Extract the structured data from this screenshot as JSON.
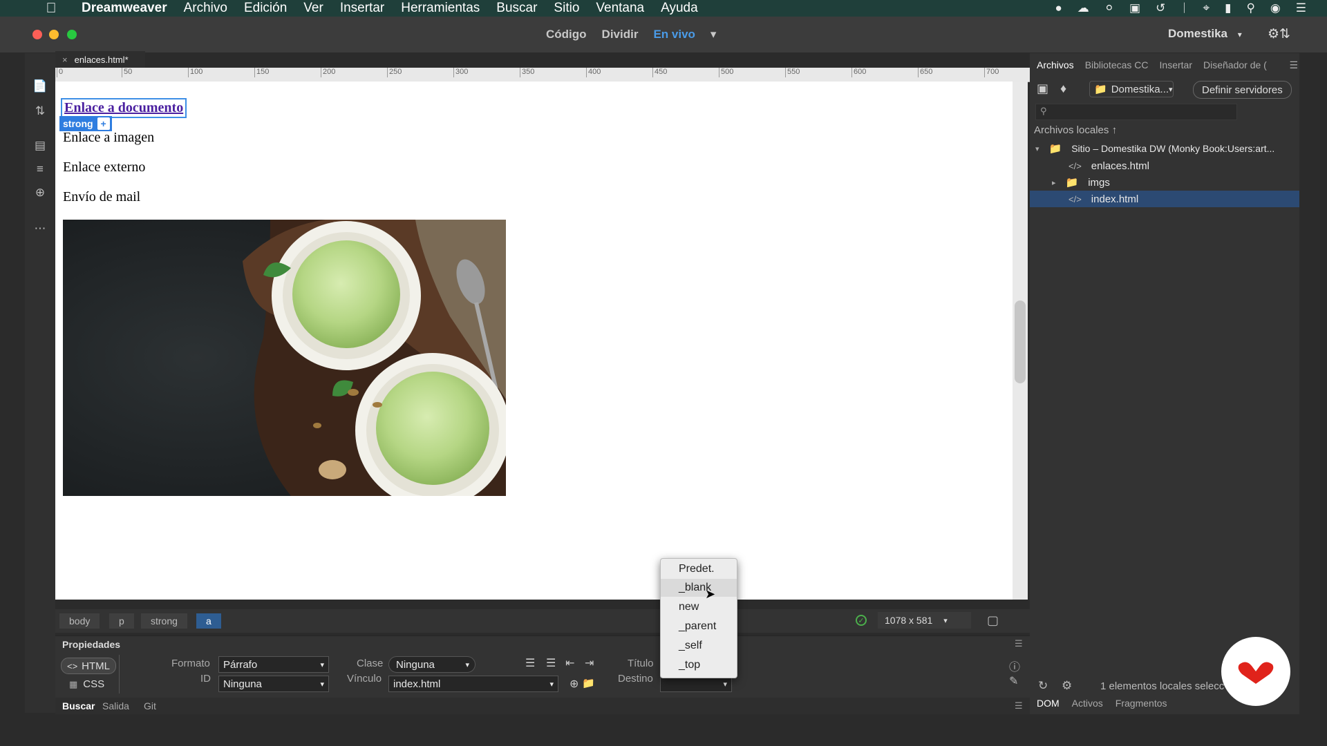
{
  "menubar": {
    "app": "Dreamweaver",
    "items": [
      "Archivo",
      "Edición",
      "Ver",
      "Insertar",
      "Herramientas",
      "Buscar",
      "Sitio",
      "Ventana",
      "Ayuda"
    ]
  },
  "titlebar": {
    "view_modes": [
      "Código",
      "Dividir",
      "En vivo"
    ],
    "active_view": "En vivo",
    "site": "Domestika"
  },
  "document": {
    "tab": "enlaces.html*",
    "ruler": [
      "0",
      "50",
      "100",
      "150",
      "200",
      "250",
      "300",
      "350",
      "400",
      "450",
      "500",
      "550",
      "600",
      "650",
      "700"
    ],
    "links": [
      "Enlace a documento",
      "Enlace a imagen",
      "Enlace externo",
      "Envío de mail"
    ],
    "tag_badge": "strong",
    "tag_badge_plus": "+"
  },
  "tag_selector": {
    "crumbs": [
      "body",
      "p",
      "strong",
      "a"
    ],
    "viewport": "1078 x 581"
  },
  "properties": {
    "header": "Propiedades",
    "mode_html": "HTML",
    "mode_css": "CSS",
    "format_label": "Formato",
    "format_value": "Párrafo",
    "id_label": "ID",
    "id_value": "Ninguna",
    "class_label": "Clase",
    "class_value": "Ninguna",
    "link_label": "Vínculo",
    "link_value": "index.html",
    "title_label": "Título",
    "target_label": "Destino"
  },
  "target_dropdown": {
    "options": [
      "Predet.",
      "_blank",
      "new",
      "_parent",
      "_self",
      "_top"
    ],
    "highlighted": "_blank"
  },
  "bottom_tabs": [
    "Buscar",
    "Salida",
    "Git"
  ],
  "files_panel": {
    "tabs": [
      "Archivos",
      "Bibliotecas CC",
      "Insertar",
      "Diseñador de ("
    ],
    "site_select": "Domestika...",
    "define_servers": "Definir servidores",
    "local_files_label": "Archivos locales",
    "tree": {
      "root": "Sitio – Domestika DW (Monky Book:Users:art...",
      "items": [
        "enlaces.html",
        "imgs",
        "index.html"
      ]
    },
    "status": "1 elementos locales selecc",
    "bottom_tabs": [
      "DOM",
      "Activos",
      "Fragmentos"
    ]
  }
}
